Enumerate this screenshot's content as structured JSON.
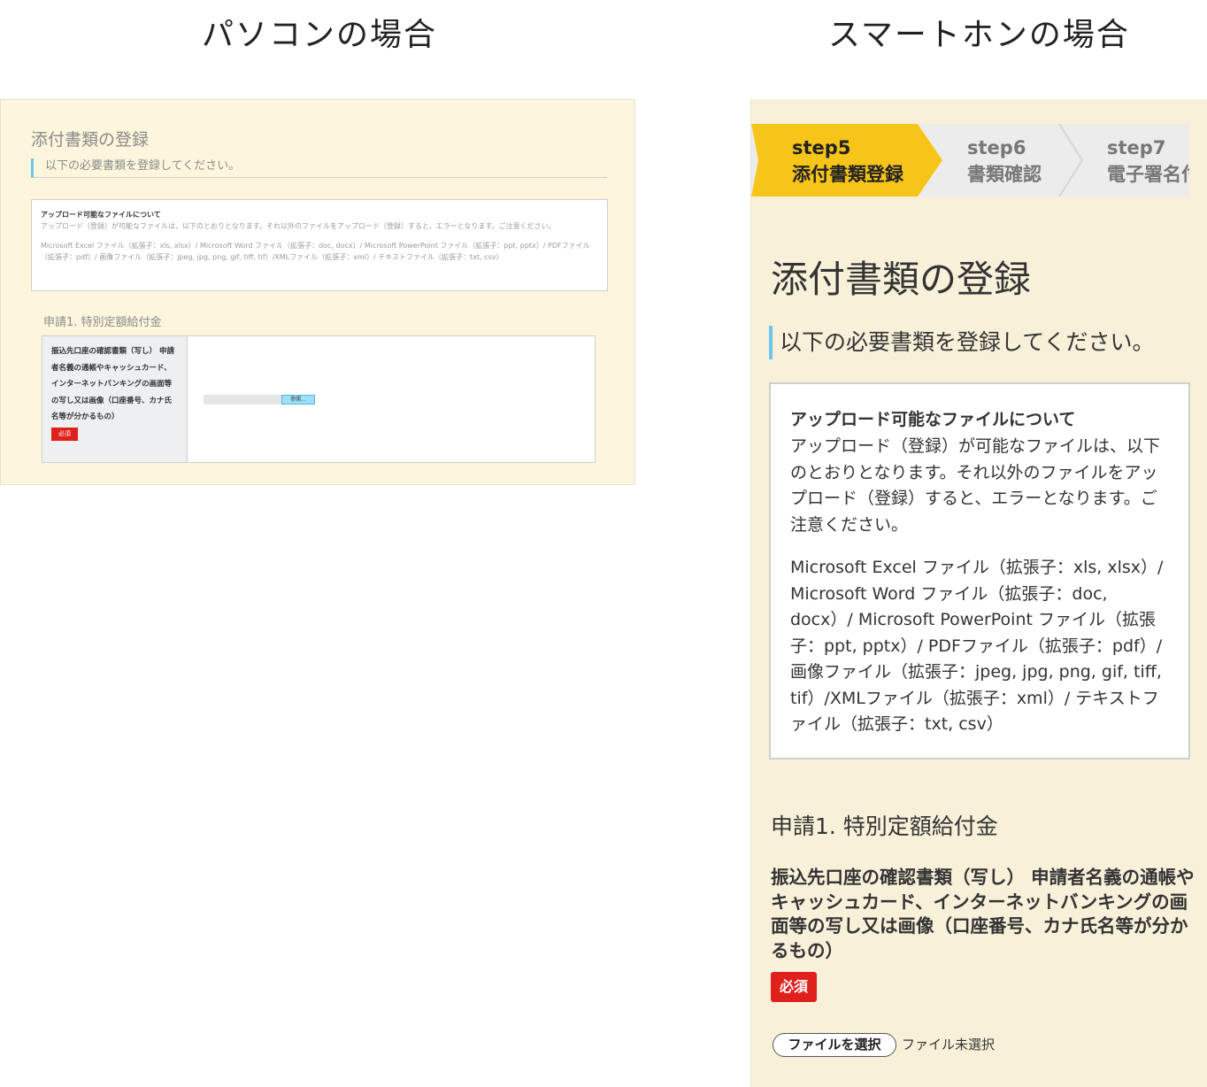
{
  "headings": {
    "pc": "パソコンの場合",
    "smartphone": "スマートホンの場合"
  },
  "pc": {
    "title": "添付書類の登録",
    "lead": "以下の必要書類を登録してください。",
    "info": {
      "heading": "アップロード可能なファイルについて",
      "body": "アップロード（登録）が可能なファイルは、以下のとおりとなります。それ以外のファイルをアップロード（登録）すると、エラーとなります。ご注意ください。",
      "types": "Microsoft Excel ファイル（拡張子：xls, xlsx）/ Microsoft Word ファイル（拡張子：doc, docx）/ Microsoft PowerPoint ファイル（拡張子：ppt, pptx）/ PDFファイル（拡張子：pdf）/ 画像ファイル（拡張子：jpeg, jpg, png, gif, tiff, tif）/XMLファイル（拡張子：xml）/ テキストファイル（拡張子：txt, csv）"
    },
    "application": "申請1. 特別定額給付金",
    "field_label": "振込先口座の確認書類（写し） 申請者名義の通帳やキャッシュカード、インターネットバンキングの画面等の写し又は画像（口座番号、カナ氏名等が分かるもの）",
    "required": "必須",
    "browse_button": "参照..."
  },
  "smartphone": {
    "steps": [
      {
        "num": "step5",
        "label": "添付書類登録",
        "active": true
      },
      {
        "num": "step6",
        "label": "書類確認",
        "active": false
      },
      {
        "num": "step7",
        "label": "電子署名付",
        "active": false
      }
    ],
    "title": "添付書類の登録",
    "lead": "以下の必要書類を登録してください。",
    "info": {
      "heading": "アップロード可能なファイルについて",
      "body": "アップロード（登録）が可能なファイルは、以下のとおりとなります。それ以外のファイルをアップロード（登録）すると、エラーとなります。ご注意ください。",
      "types": "Microsoft Excel ファイル（拡張子：xls, xlsx）/ Microsoft Word ファイル（拡張子：doc, docx）/ Microsoft PowerPoint ファイル（拡張子：ppt, pptx）/ PDFファイル（拡張子：pdf）/ 画像ファイル（拡張子：jpeg, jpg, png, gif, tiff, tif）/XMLファイル（拡張子：xml）/ テキストファイル（拡張子：txt, csv）"
    },
    "application": "申請1. 特別定額給付金",
    "field_label": "振込先口座の確認書類（写し） 申請者名義の通帳やキャッシュカード、インターネットバンキングの画面等の写し又は画像（口座番号、カナ氏名等が分かるもの）",
    "required": "必須",
    "choose_file": "ファイルを選択",
    "no_file": "ファイル未選択"
  },
  "colors": {
    "panel_bg": "#fdf6dc",
    "step_active": "#f7c51a",
    "required_bg": "#e0201c",
    "accent_bar": "#6ec6ef"
  }
}
